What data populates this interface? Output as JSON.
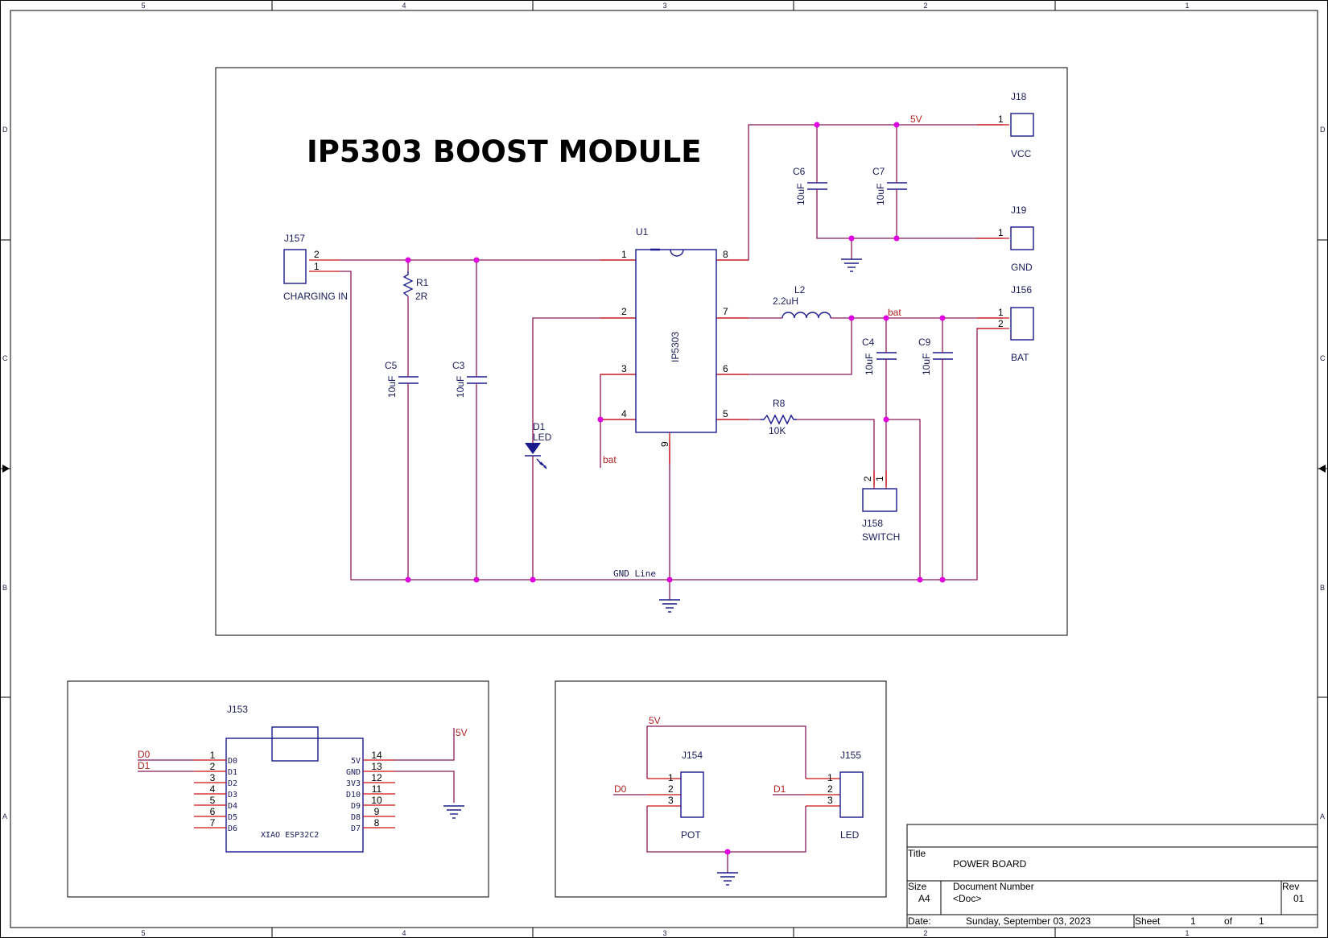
{
  "title": "IP5303 BOOST MODULE",
  "frame": {
    "col_labels": [
      "5",
      "4",
      "3",
      "2",
      "1"
    ],
    "row_labels": [
      "D",
      "C",
      "B",
      "A"
    ]
  },
  "components": {
    "J157": {
      "ref": "J157",
      "value": "CHARGING IN",
      "pins": [
        "2",
        "1"
      ]
    },
    "R1": {
      "ref": "R1",
      "value": "2R"
    },
    "C5": {
      "ref": "C5",
      "value": "10uF"
    },
    "C3": {
      "ref": "C3",
      "value": "10uF"
    },
    "D1": {
      "ref": "D1",
      "value": "LED"
    },
    "U1": {
      "ref": "U1",
      "value": "IP5303",
      "pins": [
        "1",
        "2",
        "3",
        "4",
        "8",
        "7",
        "6",
        "5",
        "9"
      ]
    },
    "L2": {
      "ref": "L2",
      "value": "2.2uH"
    },
    "R8": {
      "ref": "R8",
      "value": "10K"
    },
    "C6": {
      "ref": "C6",
      "value": "10uF"
    },
    "C7": {
      "ref": "C7",
      "value": "10uF"
    },
    "C4": {
      "ref": "C4",
      "value": "10uF"
    },
    "C9": {
      "ref": "C9",
      "value": "10uF"
    },
    "J18": {
      "ref": "J18",
      "value": "VCC",
      "pin": "1"
    },
    "J19": {
      "ref": "J19",
      "value": "GND",
      "pin": "1"
    },
    "J156": {
      "ref": "J156",
      "value": "BAT",
      "pins": [
        "1",
        "2"
      ]
    },
    "J158": {
      "ref": "J158",
      "value": "SWITCH",
      "pins": [
        "2",
        "1"
      ]
    },
    "J153": {
      "ref": "J153",
      "value": "XIAO ESP32C2",
      "left_pins": [
        {
          "num": "1",
          "name": "D0"
        },
        {
          "num": "2",
          "name": "D1"
        },
        {
          "num": "3",
          "name": "D2"
        },
        {
          "num": "4",
          "name": "D3"
        },
        {
          "num": "5",
          "name": "D4"
        },
        {
          "num": "6",
          "name": "D5"
        },
        {
          "num": "7",
          "name": "D6"
        }
      ],
      "right_pins": [
        {
          "num": "14",
          "name": "5V"
        },
        {
          "num": "13",
          "name": "GND"
        },
        {
          "num": "12",
          "name": "3V3"
        },
        {
          "num": "11",
          "name": "D10"
        },
        {
          "num": "10",
          "name": "D9"
        },
        {
          "num": "9",
          "name": "D8"
        },
        {
          "num": "8",
          "name": "D7"
        }
      ]
    },
    "J154": {
      "ref": "J154",
      "value": "POT",
      "pins": [
        "1",
        "2",
        "3"
      ]
    },
    "J155": {
      "ref": "J155",
      "value": "LED",
      "pins": [
        "1",
        "2",
        "3"
      ]
    }
  },
  "nets": {
    "v5": "5V",
    "bat_top": "bat",
    "bat_u1": "bat",
    "gnd_line": "GND Line",
    "d0_esp": "D0",
    "d1_esp": "D1",
    "v5_esp": "5V",
    "v5_pot": "5V",
    "d0_pot": "D0",
    "d1_led": "D1"
  },
  "title_block": {
    "title_label": "Title",
    "title_value": "POWER BOARD",
    "size_label": "Size",
    "size_value": "A4",
    "docnum_label": "Document Number",
    "docnum_value": "<Doc>",
    "rev_label": "Rev",
    "rev_value": "01",
    "date_label": "Date:",
    "date_value": "Sunday, September 03, 2023",
    "sheet_label": "Sheet",
    "sheet_value": "1",
    "of_label": "of",
    "of_value": "1"
  },
  "colors": {
    "wire": "#8b1a5a",
    "pin": "#cc1111",
    "body": "#1a1a8c",
    "junction": "#e000e0",
    "netlabel": "#b22222"
  }
}
